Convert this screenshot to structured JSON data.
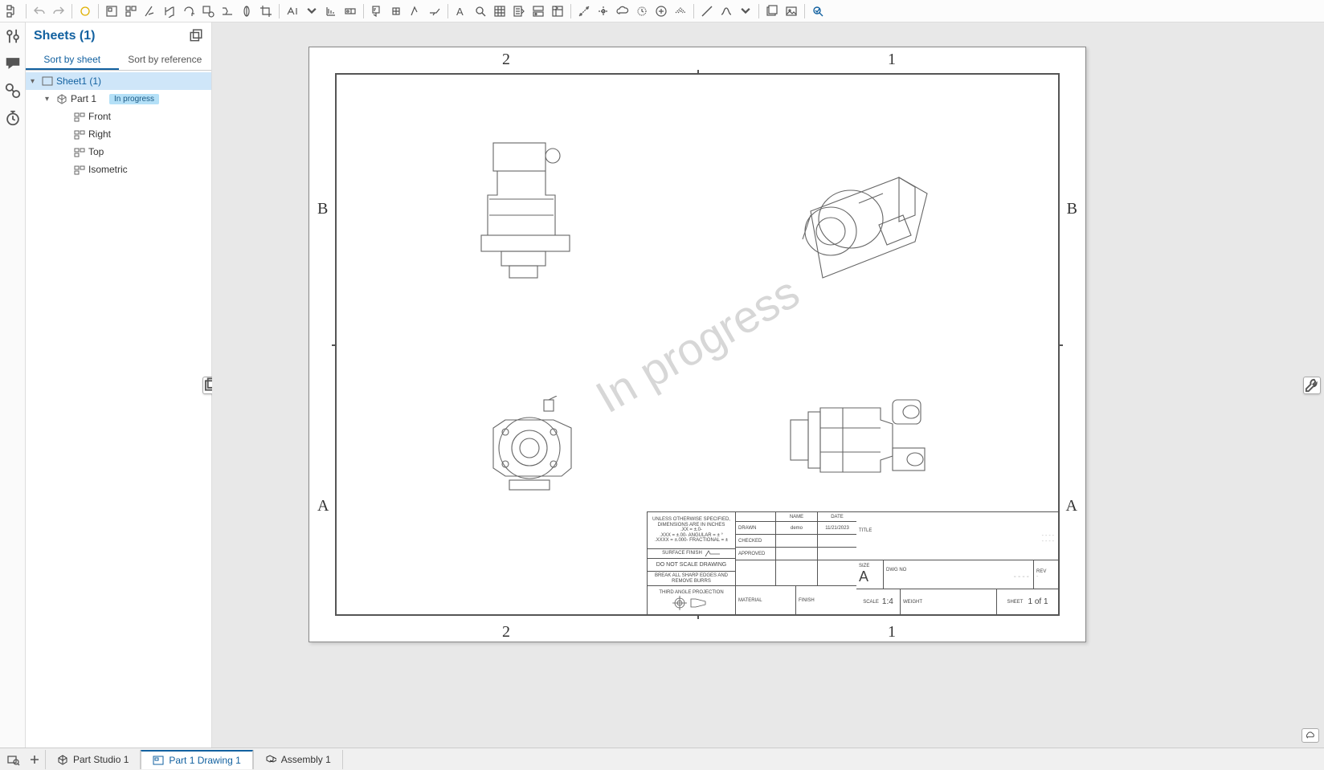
{
  "sheets_panel": {
    "title": "Sheets (1)",
    "tabs": {
      "by_sheet": "Sort by sheet",
      "by_ref": "Sort by reference"
    },
    "tree": {
      "sheet": "Sheet1 (1)",
      "part": "Part 1",
      "part_badge": "In progress",
      "views": [
        "Front",
        "Right",
        "Top",
        "Isometric"
      ]
    }
  },
  "canvas": {
    "watermark": "In progress",
    "cols": [
      "2",
      "1"
    ],
    "rows": [
      "B",
      "A"
    ]
  },
  "titleblock": {
    "tol_header": "UNLESS OTHERWISE SPECIFIED, DIMENSIONS ARE IN INCHES",
    "tol_lines": [
      ".XX = ±.0-",
      ".XXX = ±.00-   ANGULAR = ± °",
      ".XXXX = ±.000-   FRACTIONAL = ±"
    ],
    "surf": "SURFACE FINISH",
    "noscale": "DO NOT SCALE DRAWING",
    "break": "BREAK ALL SHARP EDGES AND REMOVE BURRS",
    "proj": "THIRD ANGLE PROJECTION",
    "name": "NAME",
    "date": "DATE",
    "drawn": "DRAWN",
    "drawn_name": "demo",
    "drawn_date": "11/21/2023",
    "checked": "CHECKED",
    "approved": "APPROVED",
    "material": "MATERIAL",
    "finish": "FINISH",
    "title": "TITLE",
    "size": "SIZE",
    "size_val": "A",
    "dwgno": "DWG NO",
    "rev": "REV",
    "scale": "SCALE",
    "scale_val": "1:4",
    "weight": "WEIGHT",
    "sheet": "SHEET",
    "sheet_val": "1 of 1"
  },
  "bottom_tabs": {
    "part_studio": "Part Studio 1",
    "drawing": "Part 1 Drawing 1",
    "assembly": "Assembly 1"
  }
}
